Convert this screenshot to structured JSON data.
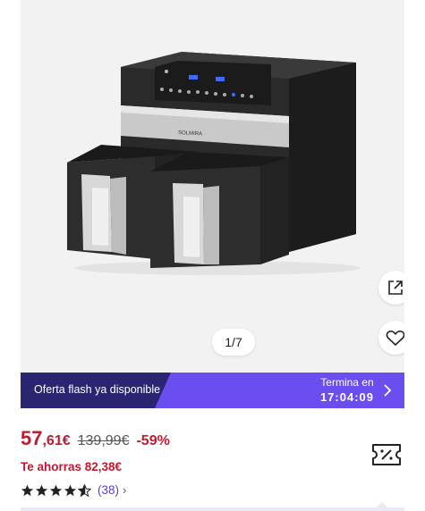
{
  "gallery": {
    "image_alt": "Freidora de aire doble SOLMIRA",
    "brand_text": "SOLMIRA",
    "counter": "1/7"
  },
  "actions": {
    "share_icon": "external-share-icon",
    "wishlist_icon": "heart-icon"
  },
  "flash": {
    "label": "Oferta flash ya disponible",
    "ends_label": "Termina en",
    "ends_time": "17:04:09",
    "gradient_start": "#2b2470",
    "gradient_end": "#6b4df0"
  },
  "price": {
    "integer": "57",
    "decimal": ",61€",
    "original": "139,99€",
    "discount": "-59%",
    "savings": "Te ahorras 82,38€",
    "accent": "#c1192f"
  },
  "rating": {
    "stars": 4.5,
    "review_count": "(38)",
    "chevron": "›"
  },
  "coupon_icon": "coupon-icon"
}
